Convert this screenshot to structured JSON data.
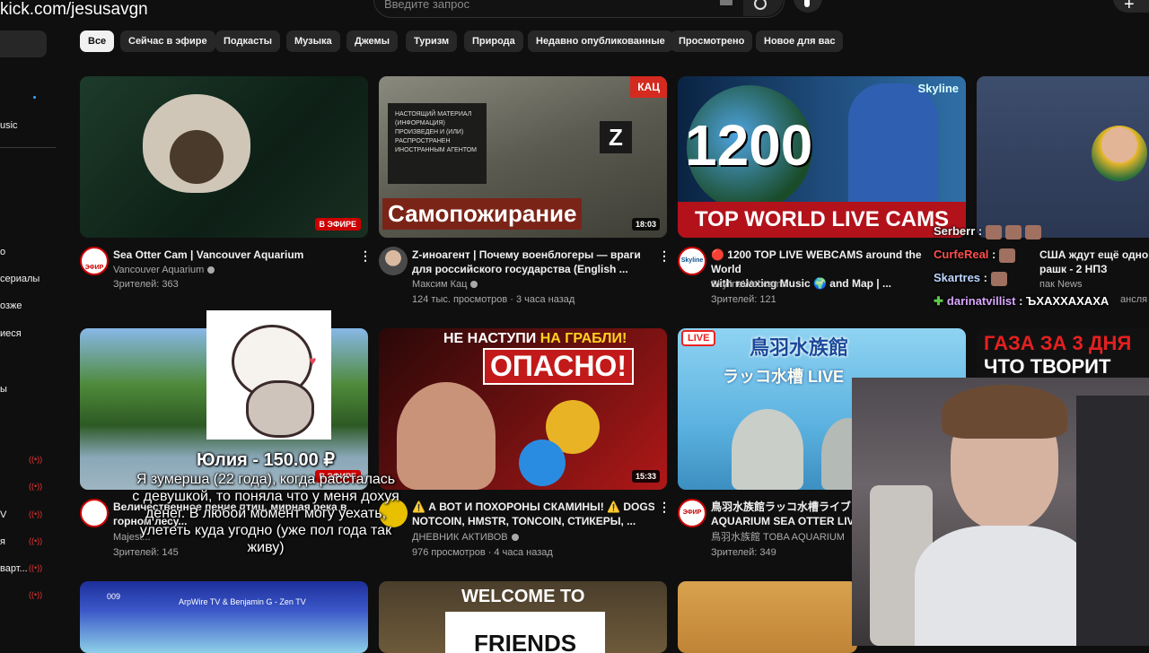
{
  "overlay": {
    "kick_url": "kick.com/jesusavgn"
  },
  "header": {
    "search_placeholder": "Введите запрос"
  },
  "sidebar": {
    "items": [
      {
        "label": "usic"
      },
      {
        "label": "о"
      },
      {
        "label": "сериалы"
      },
      {
        "label": "озже"
      },
      {
        "label": "иеся"
      },
      {
        "label": "ы"
      },
      {
        "label": "V"
      },
      {
        "label": "я"
      },
      {
        "label": "варт..."
      }
    ]
  },
  "chips": [
    "Все",
    "Сейчас в эфире",
    "Подкасты",
    "Музыка",
    "Джемы",
    "Туризм",
    "Природа",
    "Недавно опубликованные",
    "Просмотрено",
    "Новое для вас"
  ],
  "videos": [
    {
      "thumb_text": "",
      "badge": "В ЭФИРЕ",
      "title1": "Sea Otter Cam | Vancouver Aquarium",
      "title2": "",
      "channel": "Vancouver Aquarium",
      "meta": "Зрителей: 363",
      "avatar_label": "ЭФИР"
    },
    {
      "thumb_text": "Самопожирание",
      "corner": "КАЦ",
      "patch": "НАСТОЯЩИЙ МАТЕРИАЛ (ИНФОРМАЦИЯ) ПРОИЗВЕДЕН И (ИЛИ) РАСПРОСТРАНЕН ИНОСТРАННЫМ АГЕНТОМ",
      "duration": "18:03",
      "title1": "Z-иноагент | Почему военблогеры — враги",
      "title2": "для российского государства (English ...",
      "channel": "Максим Кац",
      "meta": "124 тыс. просмотров · 3 часа назад"
    },
    {
      "thumb_big": "1200",
      "thumb_text": "TOP WORLD LIVE CAMS",
      "corner": "Skyline",
      "title1": "🔴 1200 TOP LIVE WEBCAMS around the World",
      "title2": "with relaxing Music 🌍 and Map | ...",
      "channel": "SkylineWebcams",
      "meta": "Зрителей: 121",
      "avatar_label": "Skyline"
    },
    {
      "title1": "США ждут ещё одно снос",
      "title2": "рашк - 2 НПЗ",
      "channel": "пак News",
      "meta": "ансля"
    },
    {
      "badge": "В ЭФИРЕ",
      "title1": "Величественное пение птиц, мирная река в",
      "title2": "горном лесу...",
      "channel": "Majest...",
      "meta": "Зрителей: 145",
      "avatar_label": "ЭФИР"
    },
    {
      "thumb_top1": "НЕ НАСТУПИ",
      "thumb_top2": "НА ГРАБЛИ!",
      "thumb_text": "ОПАСНО!",
      "duration": "15:33",
      "title1": "⚠️ А ВОТ И ПОХОРОНЫ СКАМИНЫ! ⚠️ DOGS,",
      "title2": "NOTCOIN, HMSTR, TONCOIN, СТИКЕРЫ, ...",
      "channel": "ДНЕВНИК АКТИВОВ",
      "meta": "976 просмотров · 4 часа назад"
    },
    {
      "corner": "LIVE",
      "thumb_text": "鳥羽水族館",
      "thumb_sub": "ラッコ水槽 LIVE",
      "title1": "鳥羽水族館ラッコ水槽ライブ",
      "title2": "AQUARIUM SEA OTTER LIVE",
      "channel": "鳥羽水族館 TOBA AQUARIUM",
      "meta": "Зрителей: 349",
      "avatar_label": "ЭФИР"
    },
    {
      "thumb_text": "ГАЗА ЗА 3 ДНЯ",
      "thumb_sub": "ЧТО ТВОРИТ"
    },
    {
      "thumb_text": "ArpWire TV & Benjamin G - Zen TV",
      "corner": "009"
    },
    {
      "thumb_text": "WELCOME TO",
      "thumb_sub": "FRIENDS"
    }
  ],
  "donation": {
    "title": "Юлия - 150.00 ₽",
    "message": "Я зумерша (22 года), когда рассталась с девушкой, то поняла что у меня дохуя денег. В любой момент могу уехать, улететь куда угодно (уже пол года так живу)"
  },
  "chat": [
    {
      "user": "Serberr",
      "text": "",
      "color": "#f1f1f1"
    },
    {
      "user": "CurfeReal",
      "text": "",
      "color": "#ff4d4d"
    },
    {
      "user": "Skartres",
      "text": "",
      "color": "#bcd6ff"
    },
    {
      "user": "darinatvillist",
      "text": "ЪХАХХАХАХА",
      "color": "#d8a6ff"
    }
  ]
}
